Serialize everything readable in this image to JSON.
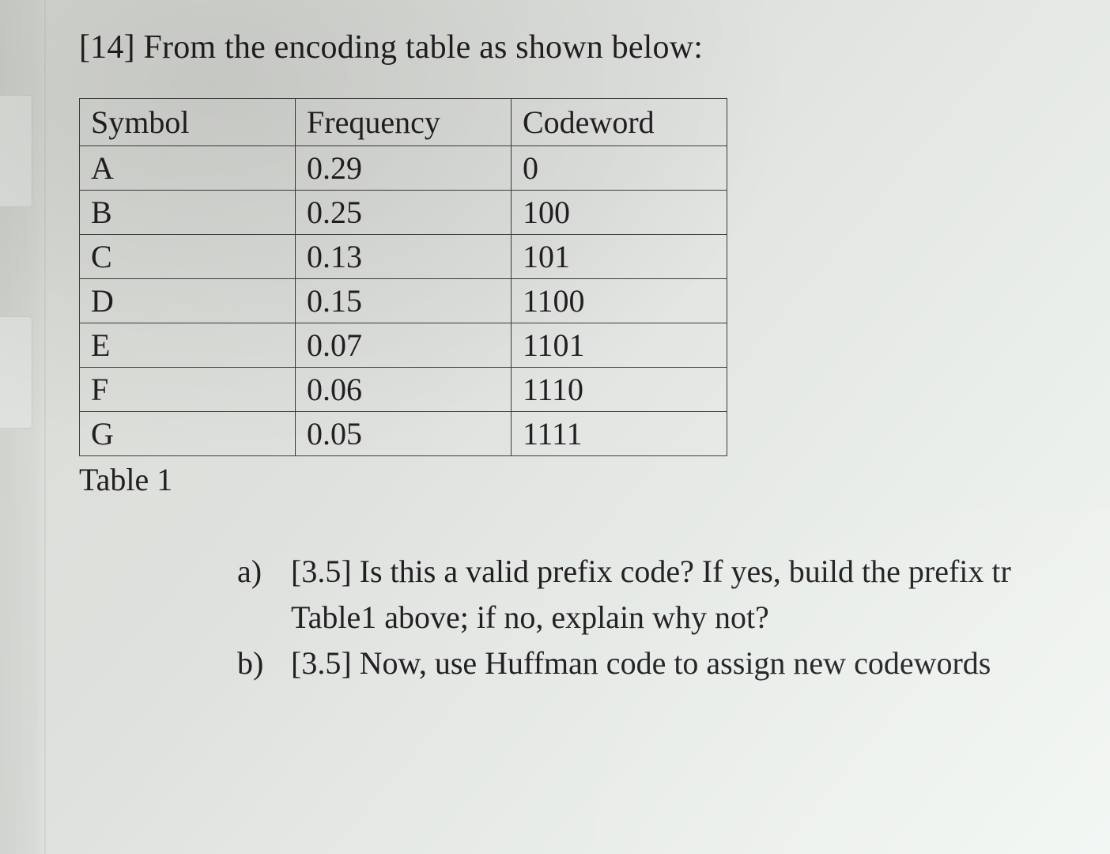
{
  "question": {
    "number_points": "[14]",
    "prompt": "From the encoding table as shown below:"
  },
  "table": {
    "headers": {
      "c1": "Symbol",
      "c2": "Frequency",
      "c3": "Codeword"
    },
    "rows": [
      {
        "symbol": "A",
        "frequency": "0.29",
        "codeword": "0"
      },
      {
        "symbol": "B",
        "frequency": "0.25",
        "codeword": "100"
      },
      {
        "symbol": "C",
        "frequency": "0.13",
        "codeword": "101"
      },
      {
        "symbol": "D",
        "frequency": "0.15",
        "codeword": "1100"
      },
      {
        "symbol": "E",
        "frequency": "0.07",
        "codeword": "1101"
      },
      {
        "symbol": "F",
        "frequency": "0.06",
        "codeword": "1110"
      },
      {
        "symbol": "G",
        "frequency": "0.05",
        "codeword": "1111"
      }
    ],
    "caption": "Table 1"
  },
  "subparts": {
    "a": {
      "label": "a)",
      "points": "[3.5]",
      "text_line1": "Is this a valid prefix code? If yes, build the prefix tr",
      "text_line2": "Table1 above; if no, explain why not?"
    },
    "b": {
      "label": "b)",
      "points": "[3.5]",
      "text_line1": "Now, use Huffman code to assign new codewords"
    }
  }
}
